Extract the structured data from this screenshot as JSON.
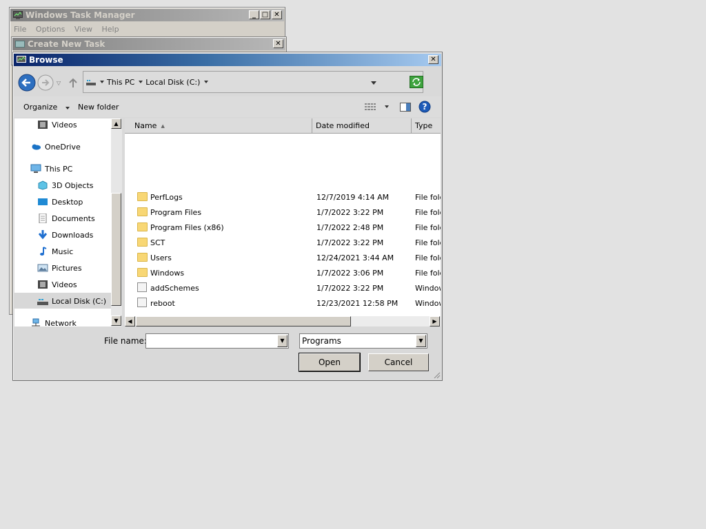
{
  "task_manager": {
    "title": "Windows Task Manager",
    "menu": [
      "File",
      "Options",
      "View",
      "Help"
    ]
  },
  "create_task": {
    "title": "Create New Task"
  },
  "browse": {
    "title": "Browse",
    "breadcrumb": [
      "This PC",
      "Local Disk (C:)"
    ],
    "toolbar": {
      "organize": "Organize",
      "new_folder": "New folder"
    },
    "nav_items": [
      {
        "label": "Videos",
        "icon": "videos-icon"
      },
      {
        "label": "OneDrive",
        "icon": "onedrive-icon"
      },
      {
        "label": "This PC",
        "icon": "this-pc-icon"
      },
      {
        "label": "3D Objects",
        "icon": "3d-objects-icon"
      },
      {
        "label": "Desktop",
        "icon": "desktop-icon"
      },
      {
        "label": "Documents",
        "icon": "documents-icon"
      },
      {
        "label": "Downloads",
        "icon": "downloads-icon"
      },
      {
        "label": "Music",
        "icon": "music-icon"
      },
      {
        "label": "Pictures",
        "icon": "pictures-icon"
      },
      {
        "label": "Videos",
        "icon": "videos-icon"
      },
      {
        "label": "Local Disk (C:)",
        "icon": "drive-icon",
        "selected": true
      },
      {
        "label": "Network",
        "icon": "network-icon"
      }
    ],
    "columns": [
      "Name",
      "Date modified",
      "Type"
    ],
    "files": [
      {
        "name": "PerfLogs",
        "date": "12/7/2019 4:14 AM",
        "type": "File fold",
        "kind": "folder"
      },
      {
        "name": "Program Files",
        "date": "1/7/2022 3:22 PM",
        "type": "File fold",
        "kind": "folder"
      },
      {
        "name": "Program Files (x86)",
        "date": "1/7/2022 2:48 PM",
        "type": "File fold",
        "kind": "folder"
      },
      {
        "name": "SCT",
        "date": "1/7/2022 3:22 PM",
        "type": "File fold",
        "kind": "folder"
      },
      {
        "name": "Users",
        "date": "12/24/2021 3:44 AM",
        "type": "File fold",
        "kind": "folder"
      },
      {
        "name": "Windows",
        "date": "1/7/2022 3:06 PM",
        "type": "File fold",
        "kind": "folder"
      },
      {
        "name": "addSchemes",
        "date": "1/7/2022 3:22 PM",
        "type": "Window",
        "kind": "file"
      },
      {
        "name": "reboot",
        "date": "12/23/2021 12:58 PM",
        "type": "Window",
        "kind": "file"
      }
    ],
    "file_name_label": "File name:",
    "file_name_value": "",
    "file_type_value": "Programs",
    "open_label": "Open",
    "cancel_label": "Cancel"
  }
}
